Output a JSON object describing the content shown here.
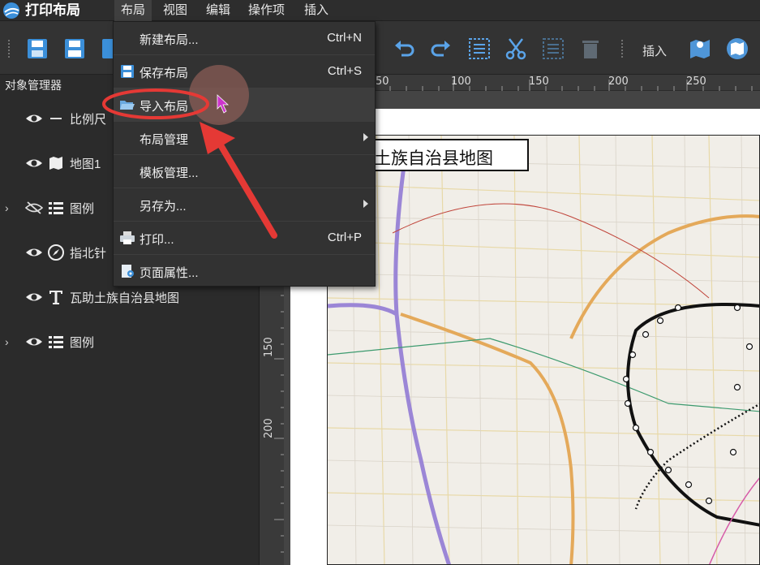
{
  "app": {
    "title": "打印布局",
    "logo_icon": "globe-logo-icon"
  },
  "menubar": {
    "items": [
      {
        "label": "布局",
        "active": true
      },
      {
        "label": "视图"
      },
      {
        "label": "编辑"
      },
      {
        "label": "操作项"
      },
      {
        "label": "插入"
      }
    ]
  },
  "toolbar": {
    "insert_label": "插入",
    "buttons": [
      "save-as-icon",
      "save-icon",
      "document-icon",
      "undo-icon",
      "redo-icon",
      "select-all-icon",
      "cut-icon",
      "deselect-icon",
      "delete-icon",
      "insert-map-icon",
      "insert-north-arrow-icon"
    ]
  },
  "object_manager": {
    "title": "对象管理器",
    "items": [
      {
        "label": "比例尺",
        "icon": "scalebar-icon",
        "visible": true,
        "expandable": false
      },
      {
        "label": "地图1",
        "icon": "map-icon",
        "visible": true,
        "expandable": false
      },
      {
        "label": "图例",
        "icon": "list-icon",
        "visible": false,
        "expandable": true
      },
      {
        "label": "指北针",
        "icon": "compass-icon",
        "visible": true,
        "expandable": false
      },
      {
        "label": "瓦助土族自治县地图",
        "icon": "text-icon",
        "visible": true,
        "expandable": false
      },
      {
        "label": "图例",
        "icon": "list-icon",
        "visible": true,
        "expandable": true
      }
    ]
  },
  "layout_menu": {
    "items": [
      {
        "label": "新建布局...",
        "shortcut": "Ctrl+N",
        "icon": ""
      },
      {
        "label": "保存布局",
        "shortcut": "Ctrl+S",
        "icon": "save-icon"
      },
      {
        "label": "导入布局",
        "shortcut": "",
        "icon": "folder-open-icon",
        "highlighted": true
      },
      {
        "label": "布局管理",
        "shortcut": "",
        "icon": "",
        "submenu": true
      },
      {
        "label": "模板管理...",
        "shortcut": "",
        "icon": ""
      },
      {
        "label": "另存为...",
        "shortcut": "",
        "icon": "",
        "submenu": true
      },
      {
        "label": "打印...",
        "shortcut": "Ctrl+P",
        "icon": "printer-icon"
      },
      {
        "label": "页面属性...",
        "shortcut": "",
        "icon": "page-properties-icon"
      }
    ]
  },
  "rulers": {
    "horizontal": [
      "50",
      "100",
      "150",
      "200",
      "250"
    ],
    "vertical": [
      "150",
      "200"
    ]
  },
  "canvas": {
    "map_title": "土族自治县地图"
  },
  "colors": {
    "accent_blue": "#3b8fd9",
    "annotation_red": "#e53935",
    "cursor_magenta": "#cc33cc"
  }
}
